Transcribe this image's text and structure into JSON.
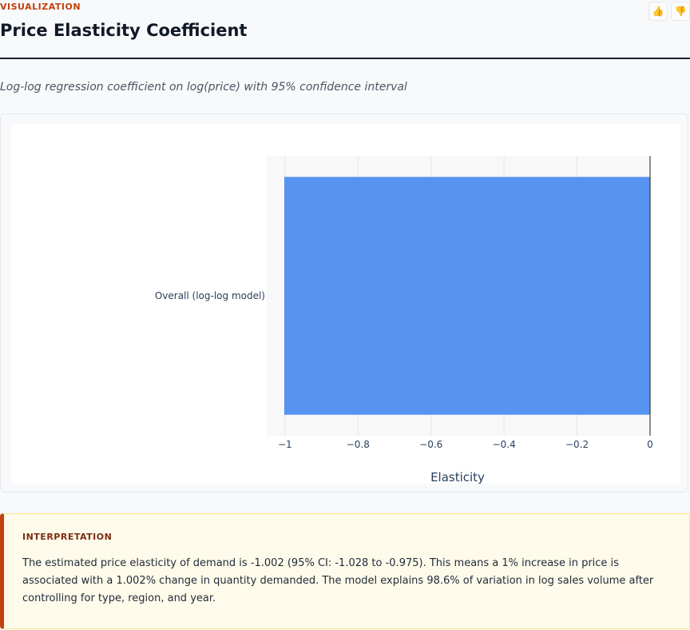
{
  "header": {
    "eyebrow": "VISUALIZATION",
    "title": "Price Elasticity Coefficient",
    "subtitle": "Log-log regression coefficient on log(price) with 95% confidence interval",
    "thumbs_up_icon": "thumbs-up-icon",
    "thumbs_down_icon": "thumbs-down-icon"
  },
  "chart_data": {
    "type": "bar",
    "orientation": "horizontal",
    "categories": [
      "Overall (log-log model)"
    ],
    "values": [
      -1.002
    ],
    "error": {
      "lower": -1.028,
      "upper": -0.975
    },
    "xlabel": "Elasticity",
    "ylabel": "",
    "xlim": [
      -1.05,
      0
    ],
    "xticks": [
      -1,
      -0.8,
      -0.6,
      -0.4,
      -0.2,
      0
    ],
    "xtick_labels": [
      "−1",
      "−0.8",
      "−0.6",
      "−0.4",
      "−0.2",
      "0"
    ],
    "grid": true,
    "bar_color": "#5794f2",
    "zero_line": true
  },
  "interpretation": {
    "label": "INTERPRETATION",
    "text": "The estimated price elasticity of demand is -1.002 (95% CI: -1.028 to -0.975). This means a 1% increase in price is associated with a 1.002% change in quantity demanded. The model explains 98.6% of variation in log sales volume after controlling for type, region, and year."
  },
  "colors": {
    "accent": "#c2410c",
    "bar": "#5794f2",
    "callout_bg": "#fffbeb"
  }
}
